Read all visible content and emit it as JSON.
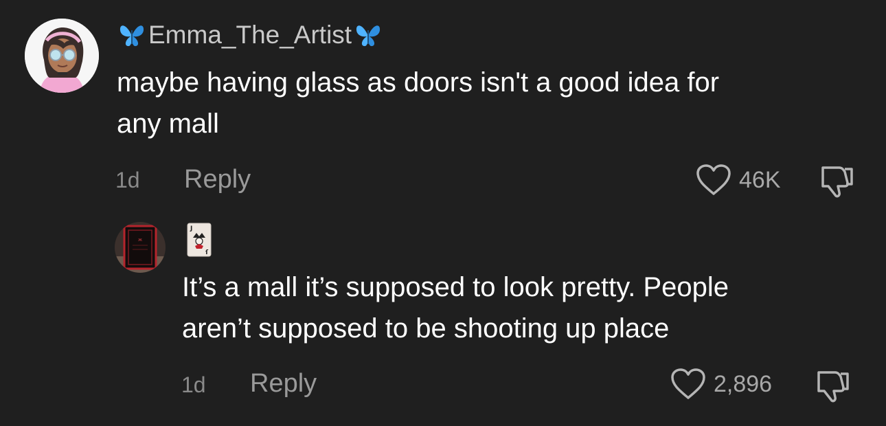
{
  "comments": [
    {
      "username": "Emma_The_Artist",
      "text_line1": "maybe having glass as doors isn't a good idea for",
      "text_line2": "any mall",
      "time": "1d",
      "reply_label": "Reply",
      "likes": "46K",
      "avatar_icon": "cartoon-girl-avatar",
      "badge_icon": "blue-butterfly-icon"
    },
    {
      "username_icon": "joker-playing-card-icon",
      "text_line1": "It’s a mall it’s supposed to look pretty. People",
      "text_line2": "aren’t supposed to be shooting up place",
      "time": "1d",
      "reply_label": "Reply",
      "likes": "2,896",
      "avatar_icon": "dark-book-avatar"
    }
  ],
  "colors": {
    "background": "#1f1f1f",
    "primary_text": "#ffffff",
    "secondary_text": "#9a9a9a",
    "butterfly": "#4fb3ff"
  }
}
